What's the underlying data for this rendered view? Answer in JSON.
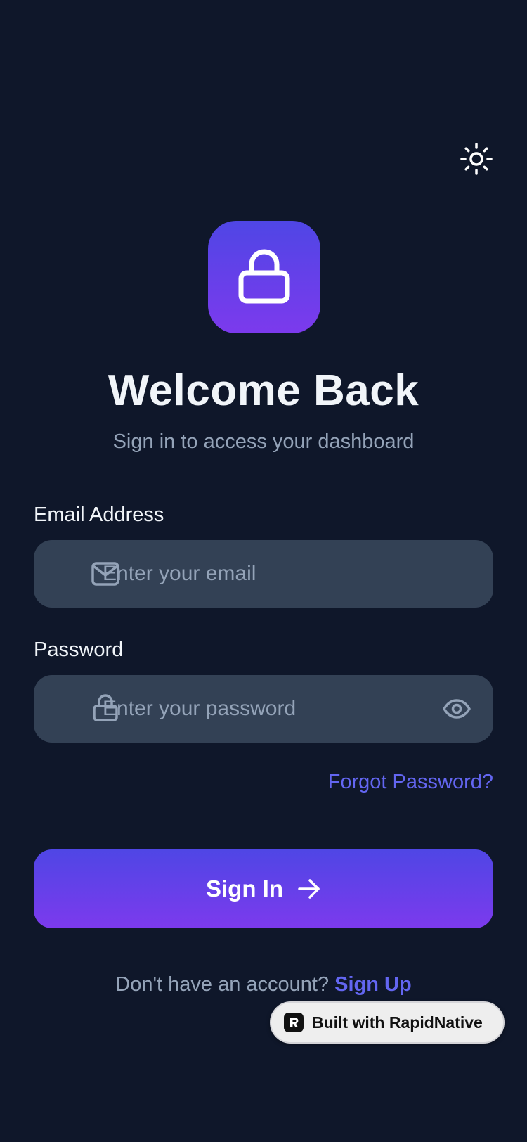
{
  "header": {
    "theme_toggle_icon": "sun-icon"
  },
  "hero": {
    "logo_icon": "lock-icon",
    "title": "Welcome Back",
    "subtitle": "Sign in to access your dashboard"
  },
  "form": {
    "email": {
      "label": "Email Address",
      "placeholder": "Enter your email",
      "value": "",
      "icon": "mail-icon"
    },
    "password": {
      "label": "Password",
      "placeholder": "Enter your password",
      "value": "",
      "icon": "lock-icon",
      "toggle_icon": "eye-icon"
    },
    "forgot_label": "Forgot Password?",
    "submit_label": "Sign In",
    "submit_icon": "arrow-right-icon"
  },
  "footer": {
    "prompt": "Don't have an account?",
    "signup_label": "Sign Up"
  },
  "badge": {
    "label": "Built with RapidNative"
  },
  "colors": {
    "background": "#0f172a",
    "input_bg": "#334155",
    "accent": "#6366f1",
    "gradient_start": "#4f46e5",
    "gradient_end": "#7c3aed",
    "text_primary": "#f1f5f9",
    "text_muted": "#94a3b8"
  }
}
